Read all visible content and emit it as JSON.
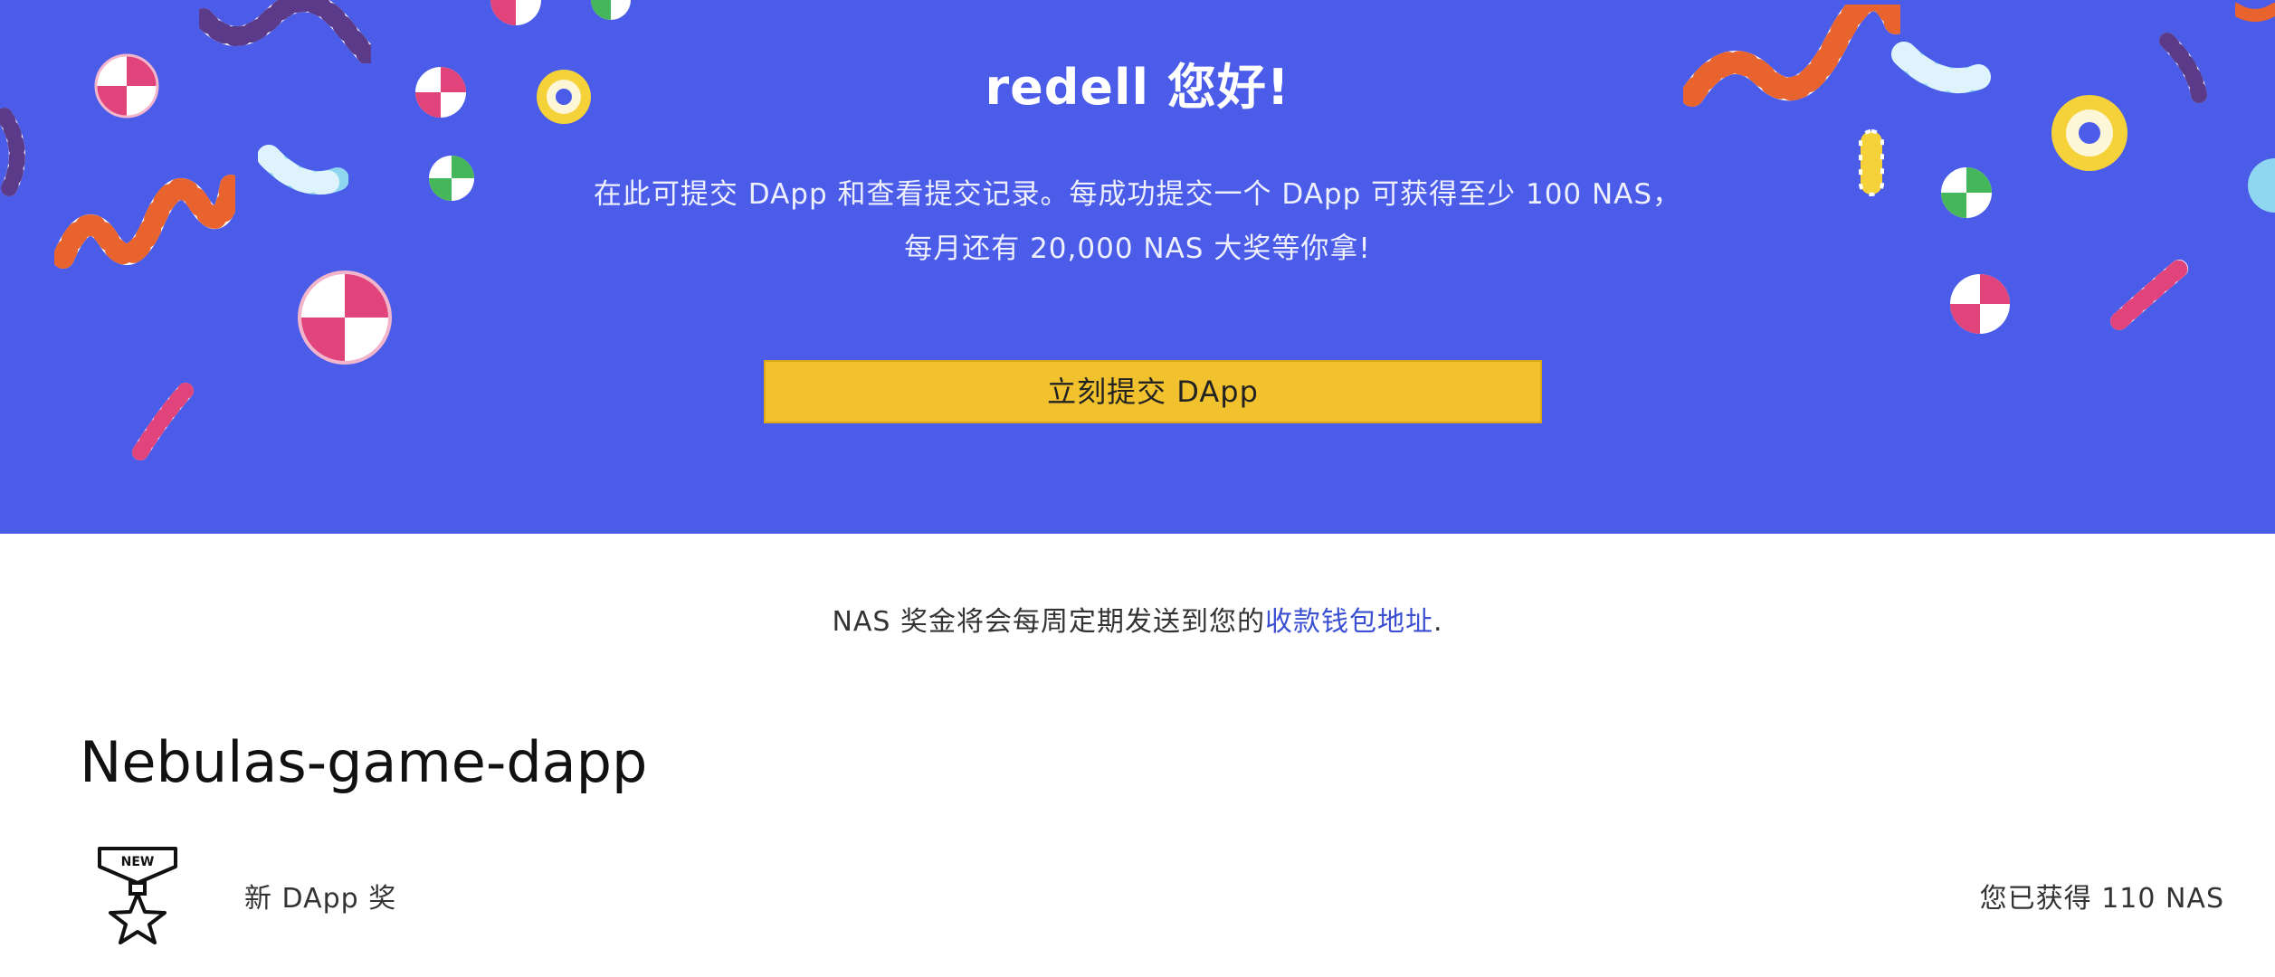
{
  "hero": {
    "greeting": "redell 您好!",
    "desc_line1": "在此可提交 DApp 和查看提交记录。每成功提交一个 DApp 可获得至少 100 NAS，",
    "desc_line2": "每月还有 20,000 NAS 大奖等你拿!",
    "submit_label": "立刻提交 DApp",
    "background_color": "#4a5ce8",
    "button_color": "#f2c22e"
  },
  "notice": {
    "prefix": "NAS 奖金将会每周定期发送到您的",
    "link_text": "收款钱包地址",
    "suffix": "."
  },
  "dapp": {
    "name": "Nebulas-game-dapp",
    "badge_icon": "new-medal-star-icon",
    "badge_text": "NEW",
    "award_label": "新 DApp 奖",
    "award_value": "您已获得 110 NAS"
  }
}
